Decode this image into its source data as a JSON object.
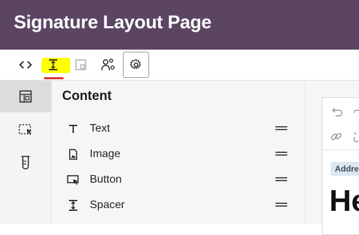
{
  "header": {
    "title": "Signature Layout Page"
  },
  "toolbar": {
    "buttons": [
      {
        "name": "code-view",
        "icon": "code-brackets-icon"
      },
      {
        "name": "spacer-tool",
        "icon": "spacer-icon",
        "highlight": "#ffff00"
      },
      {
        "name": "template",
        "icon": "template-icon"
      },
      {
        "name": "people",
        "icon": "people-settings-icon"
      },
      {
        "name": "settings",
        "icon": "gear-icon"
      }
    ]
  },
  "leftrail": {
    "items": [
      {
        "icon": "layout-icon",
        "active": true
      },
      {
        "icon": "select-area-icon",
        "active": false
      },
      {
        "icon": "flask-icon",
        "active": false
      }
    ]
  },
  "content": {
    "title": "Content",
    "items": [
      {
        "label": "Text",
        "icon": "text-icon"
      },
      {
        "label": "Image",
        "icon": "image-icon"
      },
      {
        "label": "Button",
        "icon": "button-icon"
      },
      {
        "label": "Spacer",
        "icon": "spacer-icon"
      }
    ]
  },
  "editor": {
    "tag": "Addre",
    "heading": "He"
  },
  "colors": {
    "header_bg": "#5b4563",
    "highlight": "#ffff00",
    "underline": "#d93535",
    "tag_bg": "#d9e8f2"
  }
}
